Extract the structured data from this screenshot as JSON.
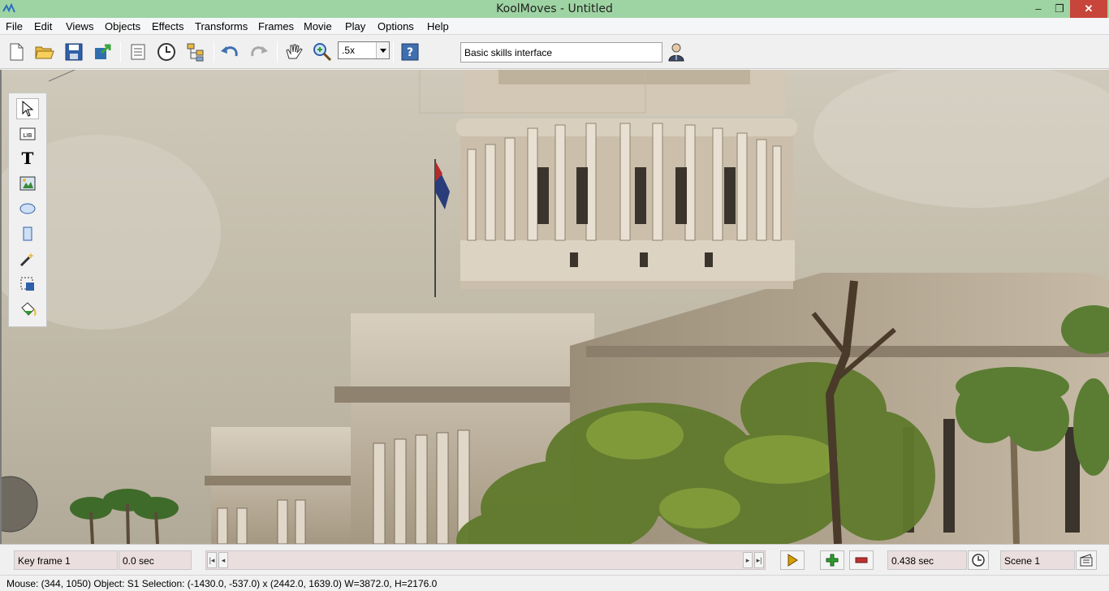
{
  "window": {
    "title": "KoolMoves - Untitled",
    "controls": {
      "minimize": "–",
      "maximize": "❐",
      "close": "✕"
    },
    "titlebar_color": "#9ed4a3",
    "close_color": "#c7453a"
  },
  "menubar": {
    "items": [
      "File",
      "Edit",
      "Views",
      "Objects",
      "Effects",
      "Transforms",
      "Frames",
      "Movie",
      "Play",
      "Options",
      "Help"
    ]
  },
  "toolbar": {
    "buttons": [
      "new-file-icon",
      "open-folder-icon",
      "save-disk-icon",
      "export-icon",
      "properties-icon",
      "clock-icon",
      "hierarchy-icon",
      "undo-icon",
      "redo-icon",
      "hand-icon",
      "zoom-icon",
      "help-icon",
      "user-icon"
    ],
    "zoom_value": ".5x",
    "mode_label": "Basic skills interface"
  },
  "tools": {
    "items": [
      "arrow-tool-icon",
      "library-icon",
      "text-tool-icon",
      "image-tool-icon",
      "ellipse-tool-icon",
      "rectangle-tool-icon",
      "magic-wand-icon",
      "transform-tool-icon",
      "paint-bucket-icon"
    ],
    "text_glyph": "T",
    "lib_glyph": "LIB"
  },
  "timeline": {
    "keyframe_label": "Key frame 1",
    "time_label": "0.0 sec",
    "duration_label": "0.438 sec",
    "scene_label": "Scene 1",
    "accent_green": "#2e9b2e",
    "accent_red": "#c03030",
    "play_color": "#d8a000"
  },
  "status": {
    "text": "Mouse: (344, 1050)  Object: S1  Selection: (-1430.0, -537.0) x (2442.0, 1639.0)  W=3872.0,  H=2176.0"
  }
}
